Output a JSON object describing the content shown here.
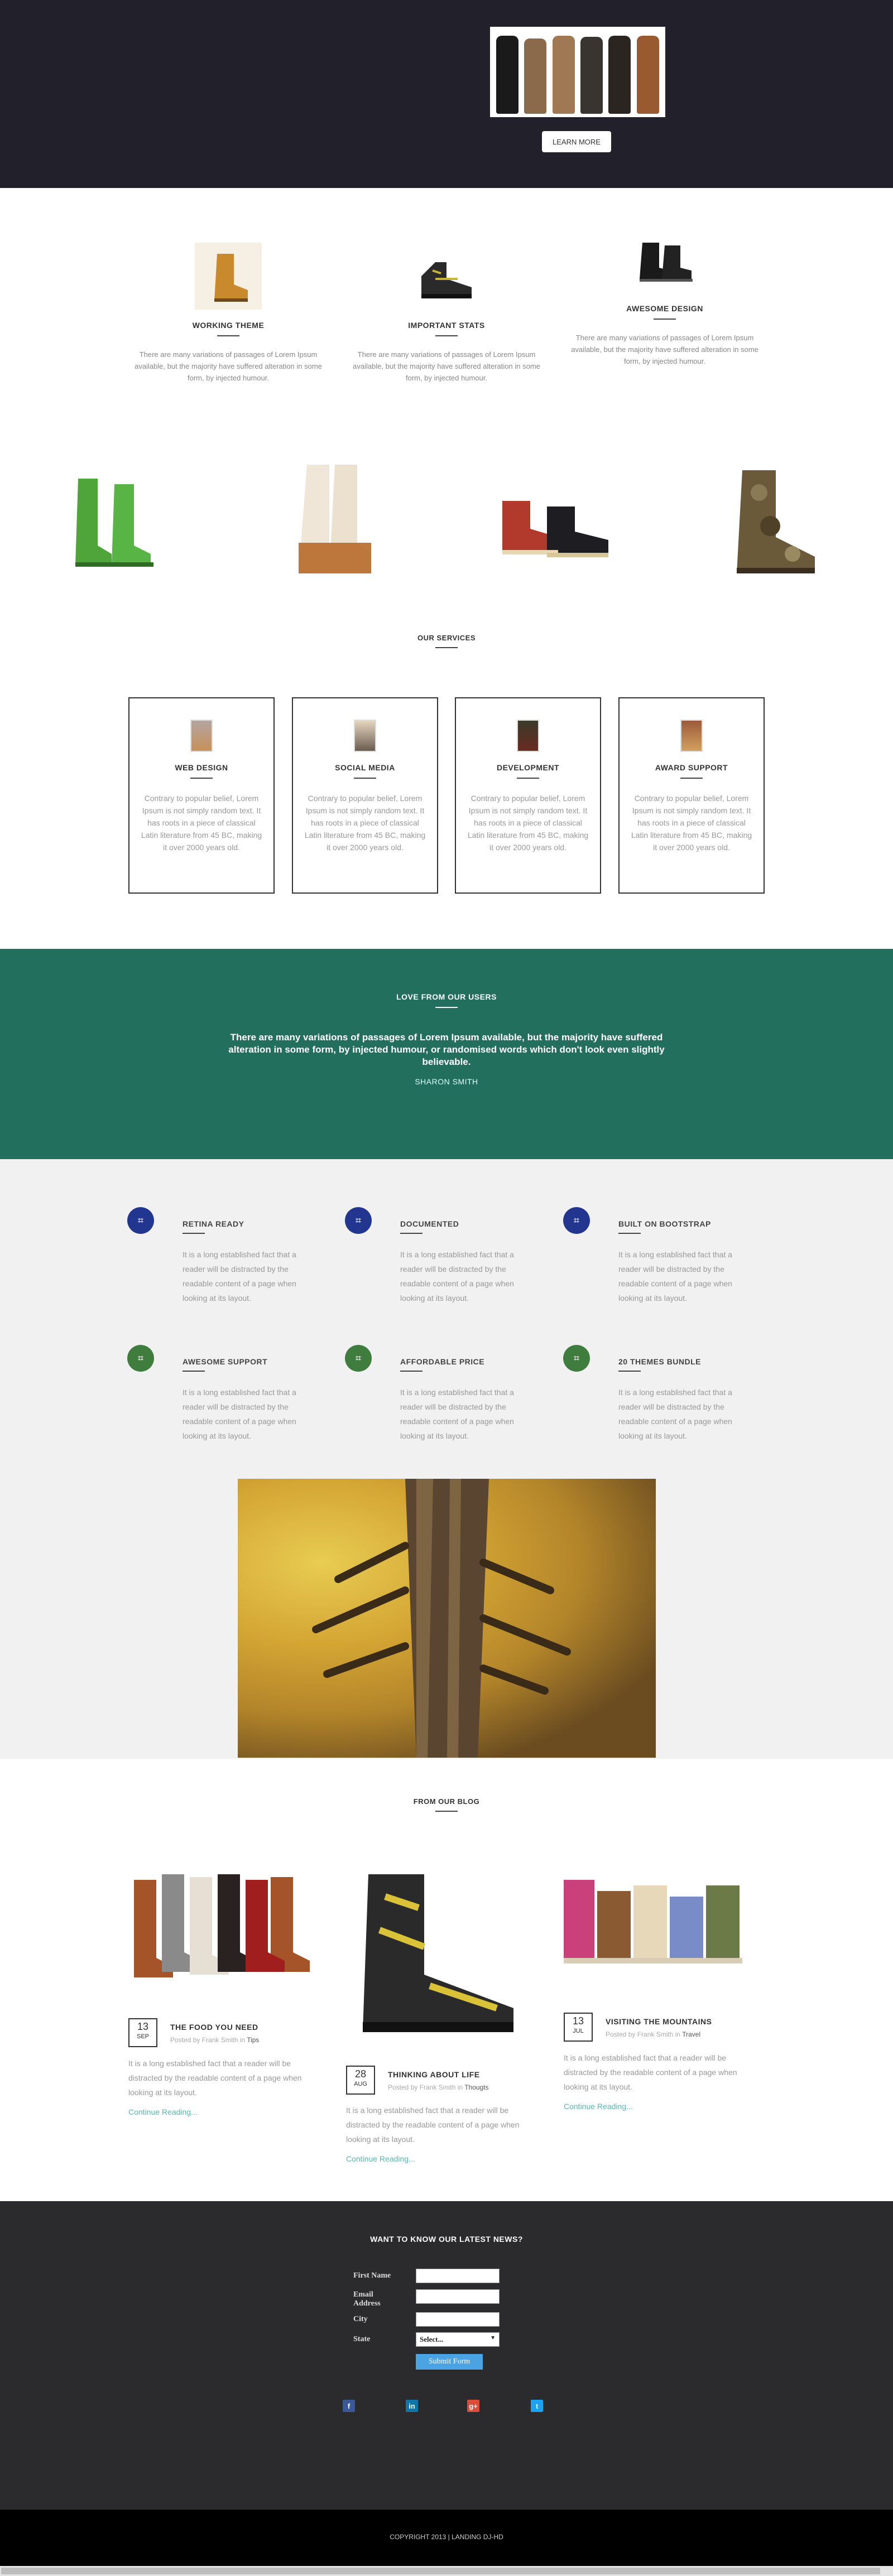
{
  "hero": {
    "button": "LEARN MORE"
  },
  "features": [
    {
      "title": "WORKING THEME",
      "text": "There are many variations of passages of Lorem Ipsum available, but the majority have suffered alteration in some form, by injected humour."
    },
    {
      "title": "IMPORTANT STATS",
      "text": "There are many variations of passages of Lorem Ipsum available, but the majority have suffered alteration in some form, by injected humour."
    },
    {
      "title": "AWESOME DESIGN",
      "text": "There are many variations of passages of Lorem Ipsum available, but the majority have suffered alteration in some form, by injected humour."
    }
  ],
  "services": {
    "title": "OUR SERVICES",
    "items": [
      {
        "title": "WEB DESIGN",
        "text": "Contrary to popular belief, Lorem Ipsum is not simply random text. It has roots in a piece of classical Latin literature from 45 BC, making it over 2000 years old."
      },
      {
        "title": "SOCIAL MEDIA",
        "text": "Contrary to popular belief, Lorem Ipsum is not simply random text. It has roots in a piece of classical Latin literature from 45 BC, making it over 2000 years old."
      },
      {
        "title": "DEVELOPMENT",
        "text": "Contrary to popular belief, Lorem Ipsum is not simply random text. It has roots in a piece of classical Latin literature from 45 BC, making it over 2000 years old."
      },
      {
        "title": "AWARD SUPPORT",
        "text": "Contrary to popular belief, Lorem Ipsum is not simply random text. It has roots in a piece of classical Latin literature from 45 BC, making it over 2000 years old."
      }
    ]
  },
  "testimonial": {
    "title": "LOVE FROM OUR USERS",
    "quote": "There are many variations of passages of Lorem Ipsum available, but the majority have suffered alteration in some form, by injected humour, or randomised words which don't look even slightly believable.",
    "author": "SHARON SMITH"
  },
  "grid": [
    {
      "title": "RETINA READY",
      "text": "It is a long established fact that a reader will be distracted by the readable content of a page when looking at its layout."
    },
    {
      "title": "DOCUMENTED",
      "text": "It is a long established fact that a reader will be distracted by the readable content of a page when looking at its layout."
    },
    {
      "title": "BUILT ON BOOTSTRAP",
      "text": "It is a long established fact that a reader will be distracted by the readable content of a page when looking at its layout."
    },
    {
      "title": "AWESOME SUPPORT",
      "text": "It is a long established fact that a reader will be distracted by the readable content of a page when looking at its layout."
    },
    {
      "title": "AFFORDABLE PRICE",
      "text": "It is a long established fact that a reader will be distracted by the readable content of a page when looking at its layout."
    },
    {
      "title": "20 THEMES BUNDLE",
      "text": "It is a long established fact that a reader will be distracted by the readable content of a page when looking at its layout."
    }
  ],
  "blog": {
    "title": "FROM OUR BLOG",
    "posts": [
      {
        "day": "13",
        "month": "SEP",
        "title": "THE FOOD YOU NEED",
        "posted": "Posted by Frank Smith in",
        "category": "Tips",
        "text": "It is a long established fact that a reader will be distracted by the readable content of a page when looking at its layout.",
        "link": "Continue Reading..."
      },
      {
        "day": "28",
        "month": "AUG",
        "title": "THINKING ABOUT LIFE",
        "posted": "Posted by Frank Smith in",
        "category": "Thougts",
        "text": "It is a long established fact that a reader will be distracted by the readable content of a page when looking at its layout.",
        "link": "Continue Reading..."
      },
      {
        "day": "13",
        "month": "JUL",
        "title": "VISITING THE MOUNTAINS",
        "posted": "Posted by Frank Smith in",
        "category": "Travel",
        "text": "It is a long established fact that a reader will be distracted by the readable content of a page when looking at its layout.",
        "link": "Continue Reading..."
      }
    ]
  },
  "newsletter": {
    "title": "WANT TO KNOW OUR LATEST NEWS?",
    "first_name": "First Name",
    "email": "Email Address",
    "city": "City",
    "state": "State",
    "select": "Select...",
    "submit": "Submit Form"
  },
  "social": {
    "facebook": "f",
    "linkedin": "in",
    "google": "g+",
    "twitter": "t"
  },
  "footer": {
    "copyright": "COPYRIGHT 2013 | LANDING DJ-HD"
  },
  "colors": {
    "hero": "#22212b",
    "teal": "#236f5d",
    "blue_icon": "#22358f",
    "green_icon": "#3f7d3e",
    "newsletter": "#2b2b2d",
    "link": "#5ab7b0"
  }
}
